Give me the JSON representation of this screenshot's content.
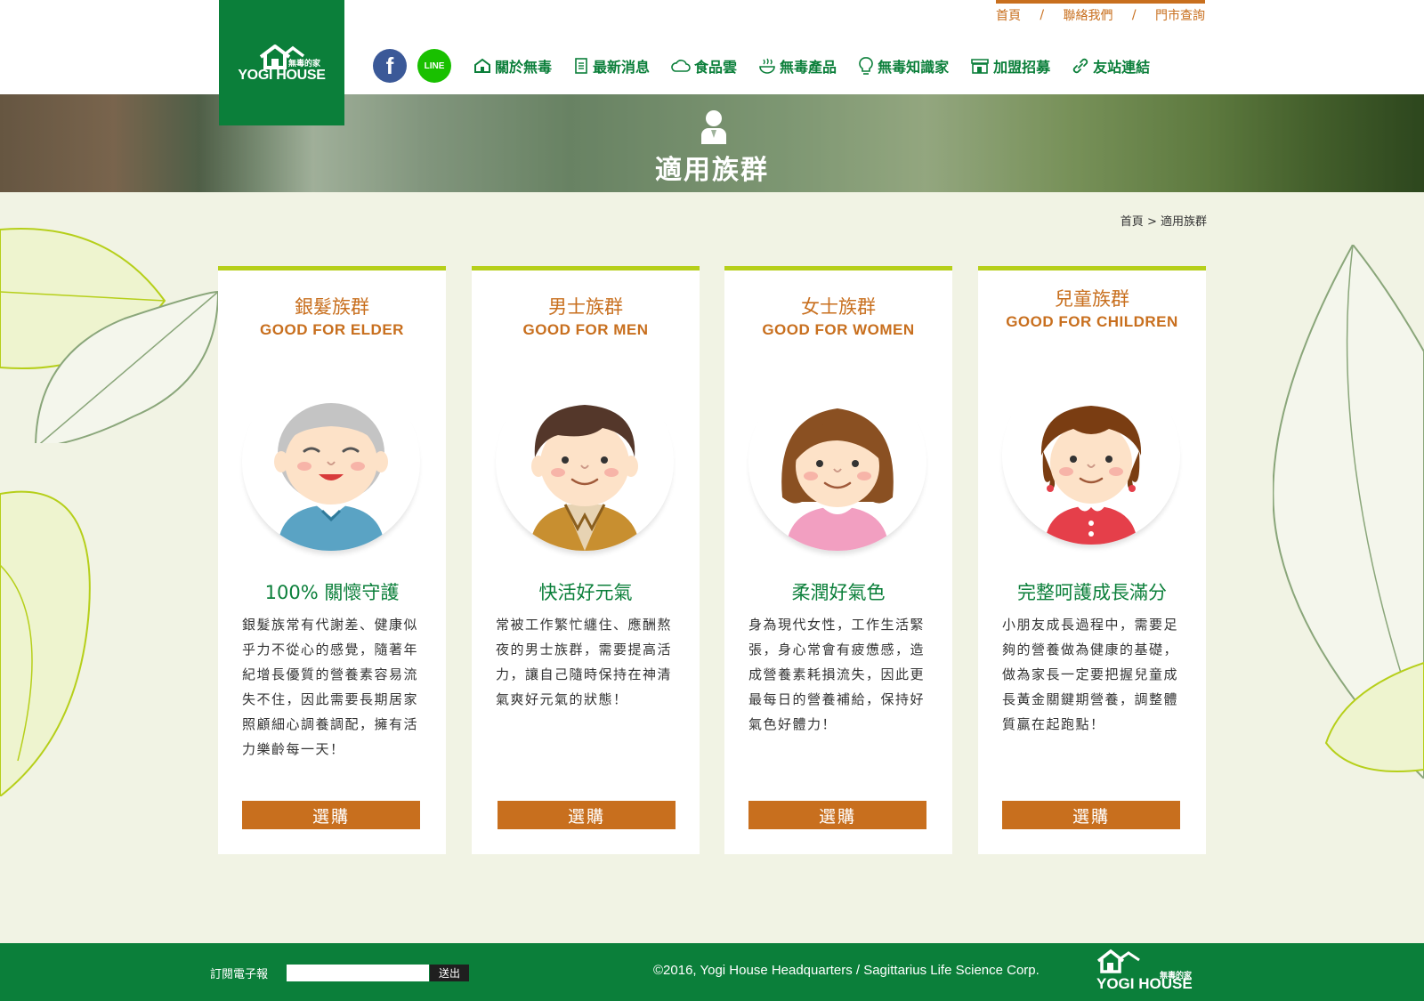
{
  "header": {
    "logo_text": "YOGI HOUSE",
    "logo_cn": "無毒的家",
    "top_links": [
      "首頁",
      "聯絡我們",
      "門市查詢"
    ],
    "top_sep": "/",
    "social": {
      "facebook": "f",
      "line": "LINE"
    },
    "nav": [
      {
        "label": "關於無毒",
        "icon": "house-icon"
      },
      {
        "label": "最新消息",
        "icon": "notepad-icon"
      },
      {
        "label": "食品雲",
        "icon": "cloud-icon"
      },
      {
        "label": "無毒產品",
        "icon": "bowl-icon"
      },
      {
        "label": "無毒知識家",
        "icon": "bulb-icon"
      },
      {
        "label": "加盟招募",
        "icon": "store-icon"
      },
      {
        "label": "友站連結",
        "icon": "link-icon"
      }
    ]
  },
  "banner": {
    "title": "適用族群",
    "icon": "person-icon"
  },
  "breadcrumb": {
    "home": "首頁",
    "sep": ">",
    "current": "適用族群"
  },
  "cards": [
    {
      "title_cn": "銀髮族群",
      "title_en": "GOOD FOR ELDER",
      "avatar": "elder-avatar",
      "headline": "100% 關懷守護",
      "text": "銀髮族常有代謝差、健康似乎力不從心的感覺，隨著年紀增長優質的營養素容易流失不住，因此需要長期居家照顧細心調養調配，擁有活力樂齡每一天！",
      "button": "選購"
    },
    {
      "title_cn": "男士族群",
      "title_en": "GOOD FOR MEN",
      "avatar": "man-avatar",
      "headline": "快活好元氣",
      "text": "常被工作繁忙纏住、應酬熬夜的男士族群，需要提高活力，讓自己隨時保持在神清氣爽好元氣的狀態！",
      "button": "選購"
    },
    {
      "title_cn": "女士族群",
      "title_en": "GOOD FOR WOMEN",
      "avatar": "woman-avatar",
      "headline": "柔潤好氣色",
      "text": "身為現代女性，工作生活緊張，身心常會有疲憊感，造成營養素耗損流失，因此更最每日的營養補給，保持好氣色好體力！",
      "button": "選購"
    },
    {
      "title_cn": "兒童族群",
      "title_en": "GOOD FOR CHILDREN",
      "avatar": "child-avatar",
      "headline": "完整呵護成長滿分",
      "text": "小朋友成長過程中，需要足夠的營養做為健康的基礎，做為家長一定要把握兒童成長黃金關鍵期營養，調整體質贏在起跑點！",
      "button": "選購"
    }
  ],
  "footer": {
    "subscribe_label": "訂閱電子報",
    "subscribe_value": "",
    "submit": "送出",
    "copyright": "©2016, Yogi House Headquarters / Sagittarius Life Science Corp.",
    "logo_text": "YOGI HOUSE",
    "logo_cn": "無毒的家"
  },
  "colors": {
    "green": "#0b7f3a",
    "orange": "#c86f1e",
    "lime": "#b6cf1a",
    "bg": "#f1f3e4"
  }
}
